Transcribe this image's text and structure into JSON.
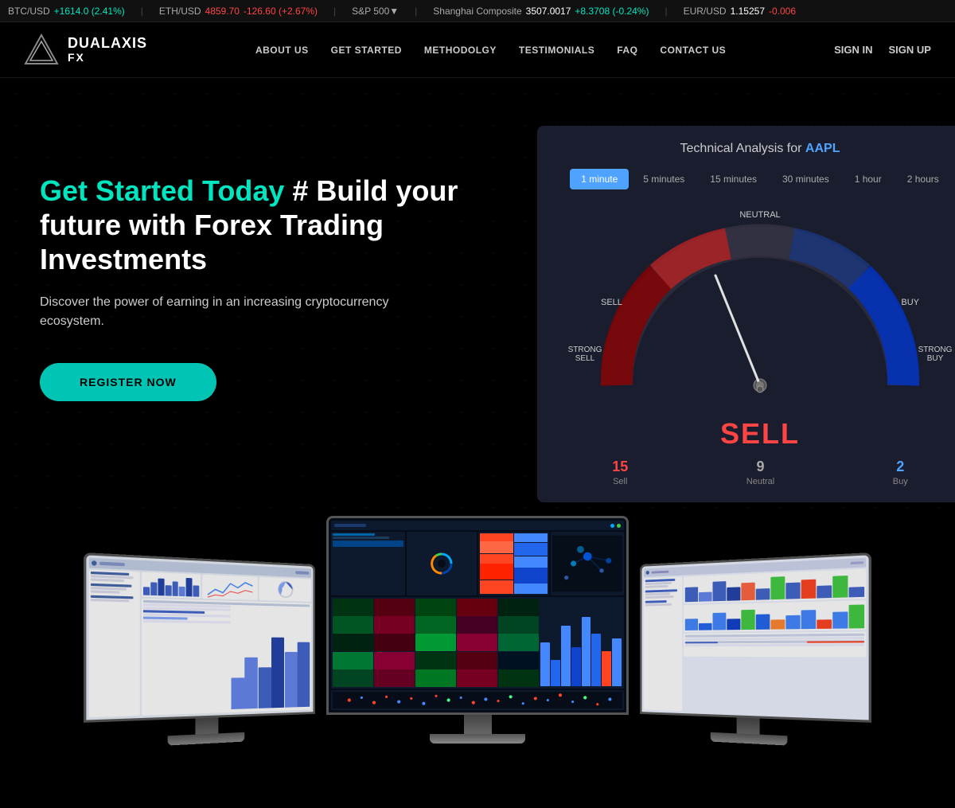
{
  "ticker": {
    "items": [
      {
        "id": "btc",
        "label": "BTC/USD",
        "value": "+1614.0",
        "change": "(+2.41%)",
        "positive": true
      },
      {
        "id": "eth",
        "label": "ETH/USD",
        "value": "4859.70",
        "change": "-126.60 (+2.67%)",
        "positive": false
      },
      {
        "id": "sp500",
        "label": "S&P 500",
        "value": "▼",
        "change": "",
        "positive": false
      },
      {
        "id": "shanghai",
        "label": "Shanghai Composite",
        "value": "3507.0017",
        "change": "+8.3708 (-0.24%)",
        "positive": true
      },
      {
        "id": "eurusd",
        "label": "EUR/USD",
        "value": "1.15257",
        "change": "-0.006",
        "positive": false
      }
    ]
  },
  "navbar": {
    "logo_text_top": "DUALAXIS",
    "logo_text_bottom": "FX",
    "links": [
      {
        "id": "about",
        "label": "ABOUT US"
      },
      {
        "id": "getstarted",
        "label": "GET STARTED"
      },
      {
        "id": "methodology",
        "label": "METHODOLGY"
      },
      {
        "id": "testimonials",
        "label": "TESTIMONIALS"
      },
      {
        "id": "faq",
        "label": "FAQ"
      },
      {
        "id": "contact",
        "label": "CONTACT US"
      }
    ],
    "auth": [
      {
        "id": "signin",
        "label": "SIGN IN"
      },
      {
        "id": "signup",
        "label": "SIGN UP"
      }
    ]
  },
  "hero": {
    "headline_accent": "Get Started Today",
    "headline_rest": " # Build your future with Forex Trading Investments",
    "subtitle": "Discover the power of earning in an increasing cryptocurrency ecosystem.",
    "cta_button": "REGISTER NOW"
  },
  "gauge": {
    "title": "Technical Analysis for ",
    "title_accent": "AAPL",
    "tabs": [
      {
        "id": "1min",
        "label": "1 minute",
        "active": true
      },
      {
        "id": "5min",
        "label": "5 minutes",
        "active": false
      },
      {
        "id": "15min",
        "label": "15 minutes",
        "active": false
      },
      {
        "id": "30min",
        "label": "30 minutes",
        "active": false
      },
      {
        "id": "1hr",
        "label": "1 hour",
        "active": false
      },
      {
        "id": "2hr",
        "label": "2 hours",
        "active": false
      }
    ],
    "labels": {
      "neutral": "NEUTRAL",
      "sell": "SELL",
      "buy": "BUY",
      "strong_sell": "STRONG SELL",
      "strong_buy": "STRONG BUY"
    },
    "result": "SELL",
    "stats": [
      {
        "id": "sell",
        "value": "15",
        "label": "Sell",
        "type": "sell"
      },
      {
        "id": "neutral",
        "value": "9",
        "label": "Neutral",
        "type": "neutral"
      },
      {
        "id": "buy",
        "value": "2",
        "label": "Buy",
        "type": "buy"
      }
    ]
  },
  "monitors": {
    "left_alt": "Trading Dashboard Left",
    "center_alt": "Trading Dashboard Center",
    "right_alt": "Trading Dashboard Right"
  },
  "colors": {
    "accent_teal": "#00e5c0",
    "accent_blue": "#4fa3ff",
    "sell_red": "#ff4444",
    "bg_dark": "#000000",
    "gauge_bg": "#1a1d2e"
  }
}
